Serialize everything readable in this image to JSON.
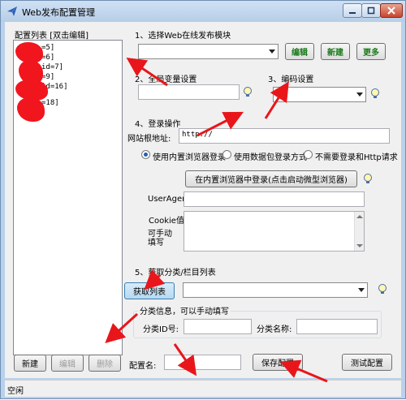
{
  "window": {
    "title": "Web发布配置管理"
  },
  "config_list": {
    "header": "配置列表 [双击编辑]",
    "items": [
      "=5]",
      "=6]",
      "id=7]",
      "=9]",
      "id=16]",
      "=18]"
    ]
  },
  "section1": {
    "title": "1、选择Web在线发布模块",
    "selected": "",
    "edit_label": "编辑",
    "new_label": "新建",
    "more_label": "更多"
  },
  "section2": {
    "title": "2、全局变量设置",
    "value": ""
  },
  "section3": {
    "title": "3、编码设置",
    "selected": ""
  },
  "section4": {
    "title": "4、登录操作",
    "root_url_label": "网站根地址:",
    "root_url_value": "http://",
    "radio_builtin": "使用内置浏览器登录",
    "radio_packet": "使用数据包登录方式",
    "radio_none": "不需要登录和Http请求",
    "login_button": "在内置浏览器中登录(点击启动微型浏览器)",
    "useragent_label": "UserAgent",
    "cookie_label": "Cookie值:",
    "manual_hint": "可手动填写"
  },
  "section5": {
    "title": "5、获取分类/栏目列表",
    "fetch_button": "获取列表",
    "category_info_title": "分类信息，可以手动填写",
    "category_id_label": "分类ID号:",
    "category_name_label": "分类名称:"
  },
  "bottom": {
    "new_label": "新建",
    "edit_label": "编辑",
    "delete_label": "删除",
    "config_name_label": "配置名:",
    "save_label": "保存配置",
    "test_label": "测试配置"
  },
  "status": {
    "text": "空闲"
  },
  "colors": {
    "arrow_red": "#e8161b",
    "accent_blue": "#1f5fb0",
    "green_text": "#1a7a1a"
  },
  "icons": {
    "app": "paper-plane-icon",
    "help": "help-bulb-icon"
  }
}
